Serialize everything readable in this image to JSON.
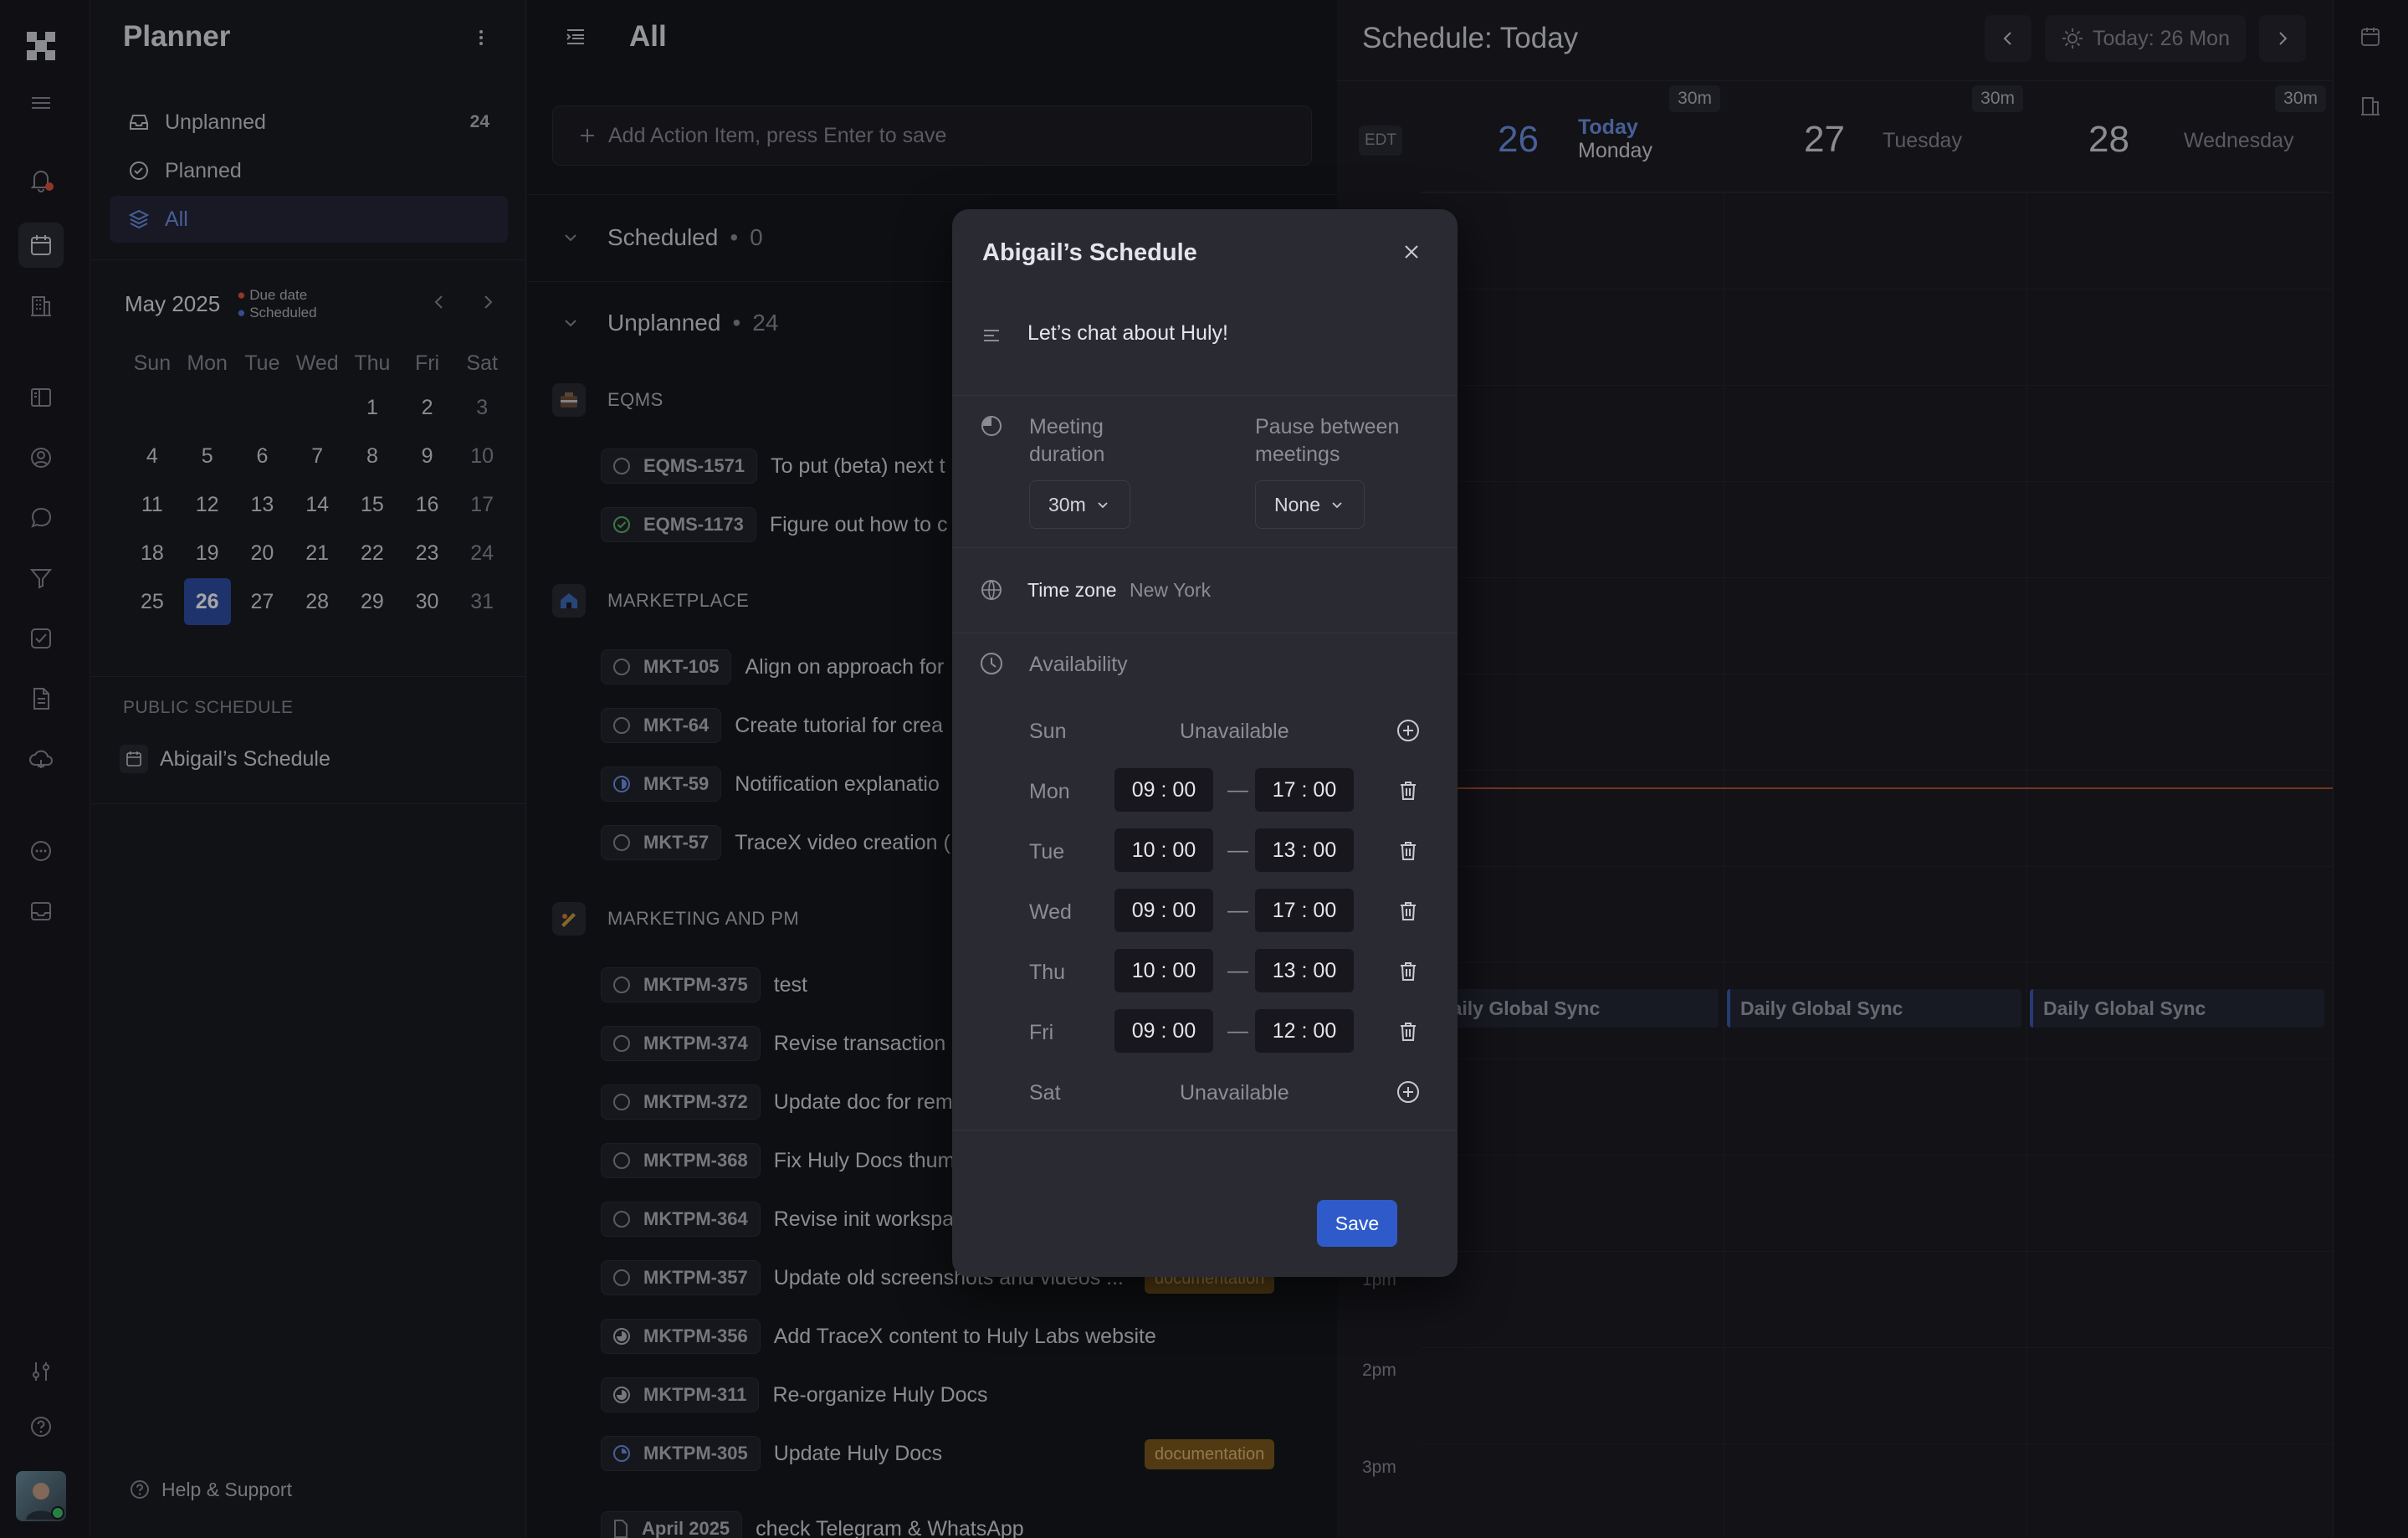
{
  "nav": {
    "title": "Planner",
    "items": [
      {
        "label": "Unplanned",
        "count": "24"
      },
      {
        "label": "Planned",
        "count": ""
      },
      {
        "label": "All",
        "count": ""
      }
    ],
    "calendar": {
      "month": "May 2025",
      "legend_due": "Due date",
      "legend_scheduled": "Scheduled",
      "weekdays": [
        "Sun",
        "Mon",
        "Tue",
        "Wed",
        "Thu",
        "Fri",
        "Sat"
      ],
      "weeks": [
        [
          "",
          "",
          "",
          "",
          "1",
          "2",
          "3"
        ],
        [
          "4",
          "5",
          "6",
          "7",
          "8",
          "9",
          "10"
        ],
        [
          "11",
          "12",
          "13",
          "14",
          "15",
          "16",
          "17"
        ],
        [
          "18",
          "19",
          "20",
          "21",
          "22",
          "23",
          "24"
        ],
        [
          "25",
          "26",
          "27",
          "28",
          "29",
          "30",
          "31"
        ]
      ],
      "today": "26"
    },
    "public_schedule_label": "PUBLIC SCHEDULE",
    "schedule_name": "Abigail’s Schedule",
    "help": "Help & Support"
  },
  "list": {
    "title": "All",
    "add_placeholder": "Add Action Item, press Enter to save",
    "scheduled": {
      "label": "Scheduled",
      "count": "0"
    },
    "unplanned": {
      "label": "Unplanned",
      "count": "24"
    },
    "groups": [
      {
        "name": "EQMS",
        "items": [
          {
            "id": "EQMS-1571",
            "title": "To put (beta) next t"
          },
          {
            "id": "EQMS-1173",
            "title": "Figure out how to c"
          }
        ]
      },
      {
        "name": "MARKETPLACE",
        "items": [
          {
            "id": "MKT-105",
            "title": "Align on approach for"
          },
          {
            "id": "MKT-64",
            "title": "Create tutorial for crea"
          },
          {
            "id": "MKT-59",
            "title": "Notification explanatio"
          },
          {
            "id": "MKT-57",
            "title": "TraceX video creation ("
          }
        ]
      },
      {
        "name": "MARKETING AND PM",
        "items": [
          {
            "id": "MKTPM-375",
            "title": "test"
          },
          {
            "id": "MKTPM-374",
            "title": "Revise transaction"
          },
          {
            "id": "MKTPM-372",
            "title": "Update doc for rem"
          },
          {
            "id": "MKTPM-368",
            "title": "Fix Huly Docs thum"
          },
          {
            "id": "MKTPM-364",
            "title": "Revise init workspa"
          },
          {
            "id": "MKTPM-357",
            "title": "Update old screenshots and videos ...",
            "tag": "documentation"
          },
          {
            "id": "MKTPM-356",
            "title": "Add TraceX content to Huly Labs website"
          },
          {
            "id": "MKTPM-311",
            "title": "Re-organize Huly Docs"
          },
          {
            "id": "MKTPM-305",
            "title": "Update Huly Docs",
            "tag": "documentation"
          }
        ]
      }
    ],
    "last_item": {
      "id": "April 2025",
      "title": "check Telegram & WhatsApp"
    }
  },
  "schedule": {
    "title": "Schedule: Today",
    "today_button": "Today: 26 Mon",
    "timezone_badge": "EDT",
    "days": [
      {
        "num": "26",
        "today": "Today",
        "name": "Monday",
        "dur": "30m"
      },
      {
        "num": "27",
        "name": "Tuesday",
        "dur": "30m"
      },
      {
        "num": "28",
        "name": "Wednesday",
        "dur": "30m"
      }
    ],
    "event": "Daily Global Sync",
    "times": [
      "1pm",
      "2pm",
      "3pm"
    ]
  },
  "modal": {
    "title": "Abigail’s Schedule",
    "description": "Let’s chat about Huly!",
    "meeting_duration_label": "Meeting duration",
    "meeting_duration_value": "30m",
    "pause_label": "Pause between meetings",
    "pause_value": "None",
    "timezone_label": "Time zone",
    "timezone_value": "New York",
    "availability_label": "Availability",
    "unavailable": "Unavailable",
    "dash": "—",
    "days": [
      {
        "day": "Sun",
        "from": "",
        "to": ""
      },
      {
        "day": "Mon",
        "from": "09 : 00",
        "to": "17 : 00"
      },
      {
        "day": "Tue",
        "from": "10 : 00",
        "to": "13 : 00"
      },
      {
        "day": "Wed",
        "from": "09 : 00",
        "to": "17 : 00"
      },
      {
        "day": "Thu",
        "from": "10 : 00",
        "to": "13 : 00"
      },
      {
        "day": "Fri",
        "from": "09 : 00",
        "to": "12 : 00"
      },
      {
        "day": "Sat",
        "from": "",
        "to": ""
      }
    ],
    "save": "Save"
  },
  "colors": {
    "accent": "#2e5bc9",
    "today_blue": "#6e93e6",
    "tag_bg": "#7d5a1e",
    "now_line": "#b2502e"
  }
}
